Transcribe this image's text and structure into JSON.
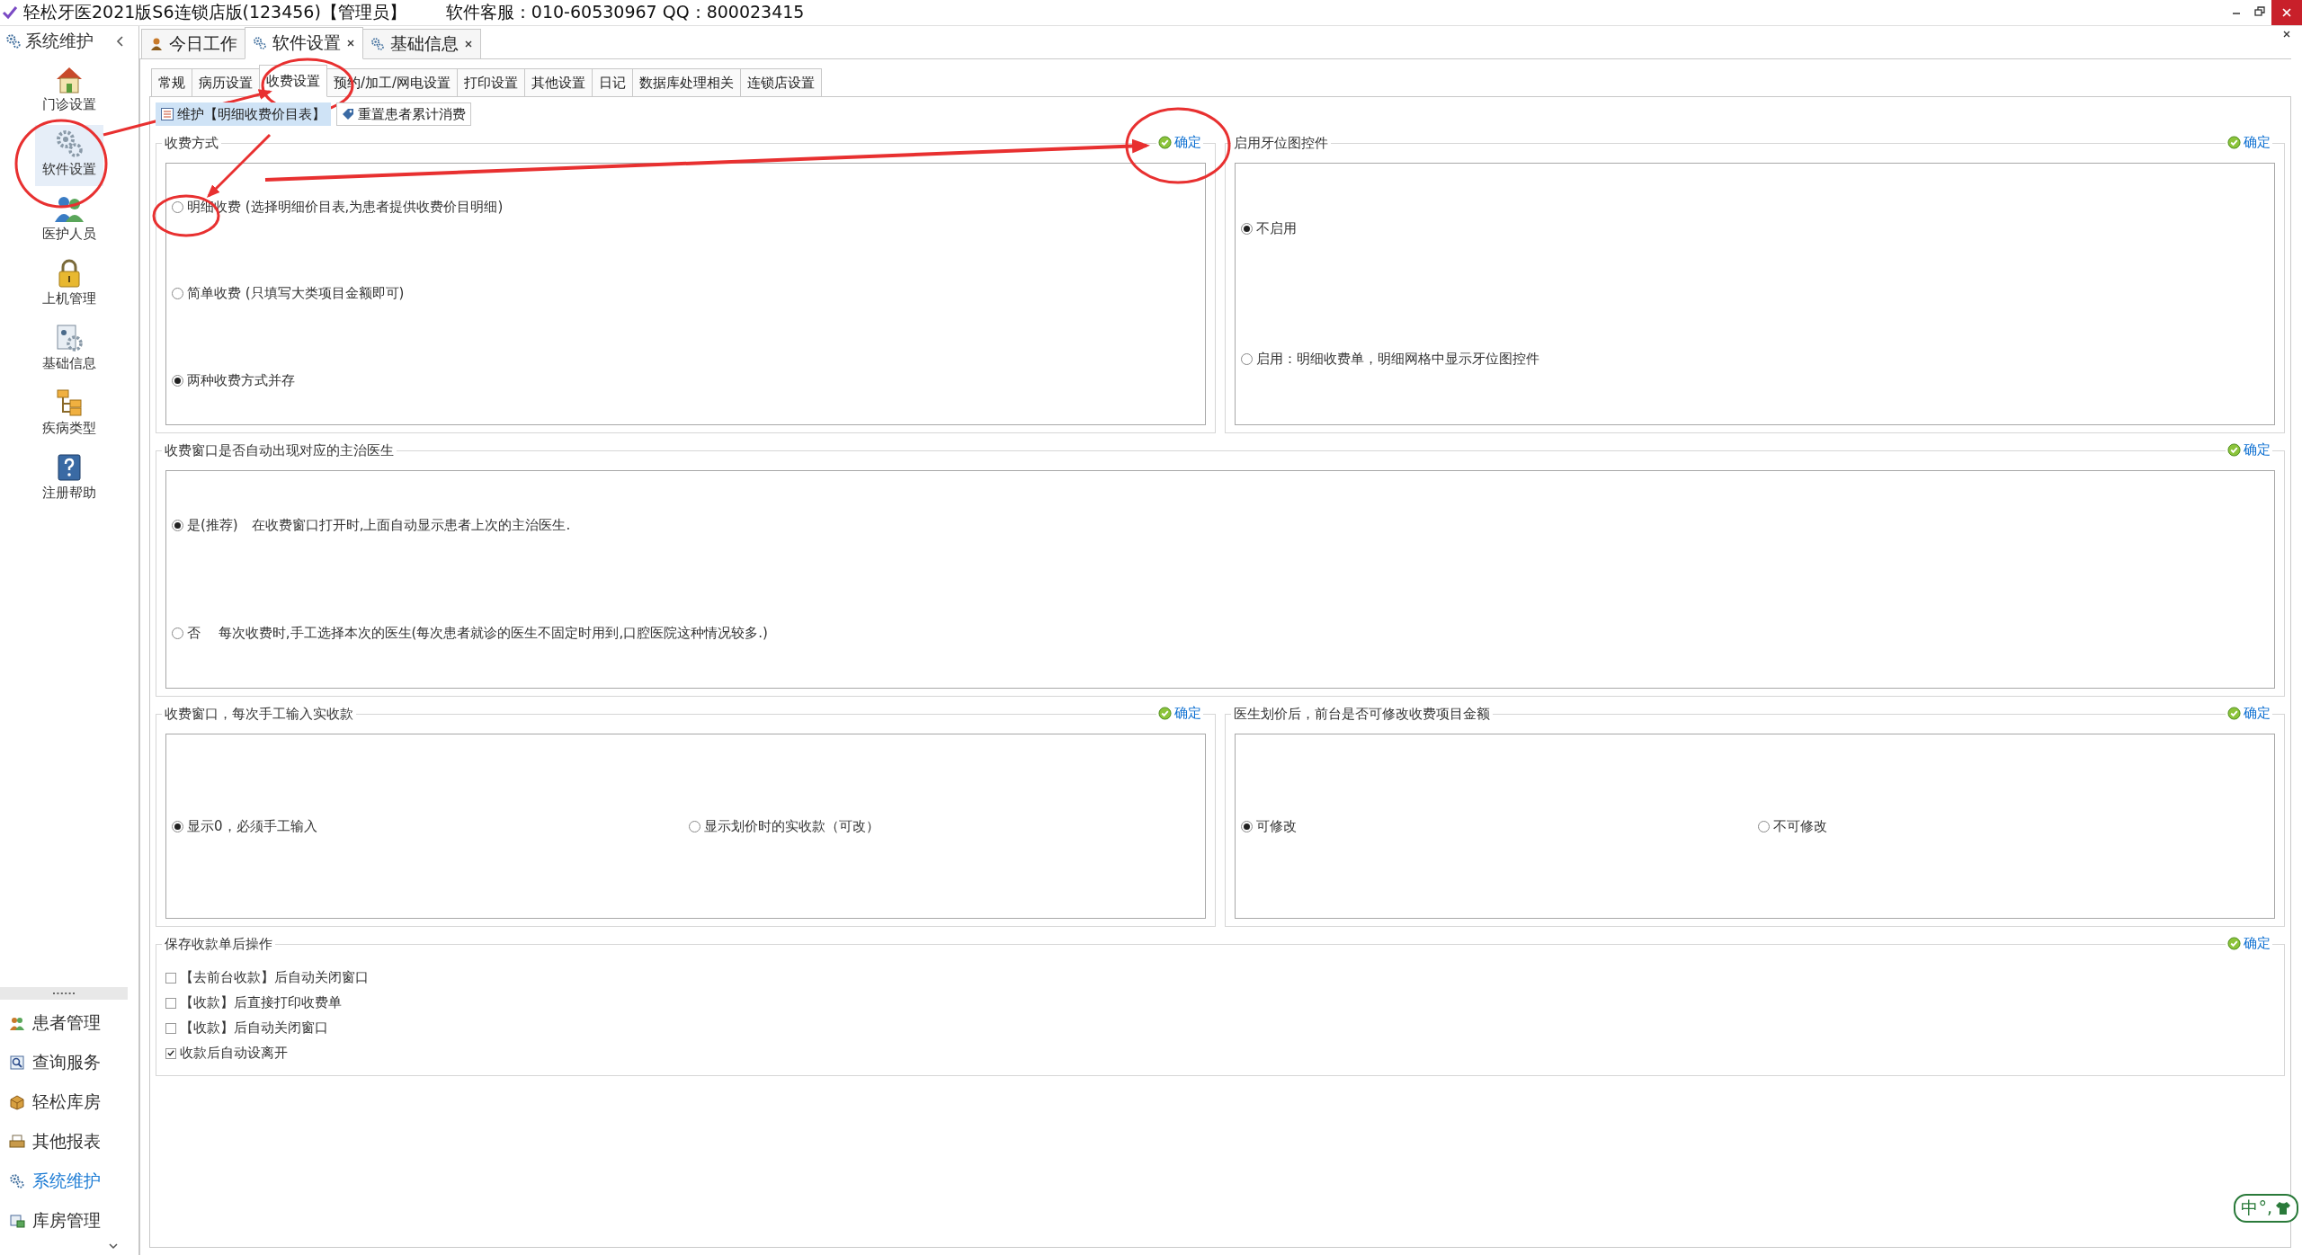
{
  "window": {
    "title": "轻松牙医2021版S6连锁店版(123456)【管理员】",
    "service": "软件客服：010-60530967 QQ：800023415"
  },
  "sidebar": {
    "header": "系统维护",
    "tools": [
      {
        "label": "门诊设置",
        "selected": false
      },
      {
        "label": "软件设置",
        "selected": true
      },
      {
        "label": "医护人员",
        "selected": false
      },
      {
        "label": "上机管理",
        "selected": false
      },
      {
        "label": "基础信息",
        "selected": false
      },
      {
        "label": "疾病类型",
        "selected": false
      },
      {
        "label": "注册帮助",
        "selected": false
      }
    ],
    "modules": [
      {
        "label": "患者管理",
        "selected": false
      },
      {
        "label": "查询服务",
        "selected": false
      },
      {
        "label": "轻松库房",
        "selected": false
      },
      {
        "label": "其他报表",
        "selected": false
      },
      {
        "label": "系统维护",
        "selected": true
      },
      {
        "label": "库房管理",
        "selected": false
      }
    ]
  },
  "doc_tabs": [
    {
      "label": "今日工作",
      "closable": false,
      "selected": false
    },
    {
      "label": "软件设置",
      "closable": true,
      "selected": true
    },
    {
      "label": "基础信息",
      "closable": true,
      "selected": false
    }
  ],
  "settings_tabs": [
    {
      "label": "常规",
      "selected": false
    },
    {
      "label": "病历设置",
      "selected": false
    },
    {
      "label": "收费设置",
      "selected": true
    },
    {
      "label": "预约/加工/网电设置",
      "selected": false
    },
    {
      "label": "打印设置",
      "selected": false
    },
    {
      "label": "其他设置",
      "selected": false
    },
    {
      "label": "日记",
      "selected": false
    },
    {
      "label": "数据库处理相关",
      "selected": false
    },
    {
      "label": "连锁店设置",
      "selected": false
    }
  ],
  "toolbar": [
    {
      "label": "维护【明细收费价目表】",
      "selected": true
    },
    {
      "label": "重置患者累计消费",
      "selected": false
    }
  ],
  "rows": [
    {
      "sections": [
        {
          "title": "收费方式",
          "confirm": "确定",
          "kind": "radios",
          "options": [
            {
              "label": "明细收费 (选择明细价目表,为患者提供收费价目明细)",
              "selected": false
            },
            {
              "label": "简单收费 (只填写大类项目金额即可)",
              "selected": false
            },
            {
              "label": "两种收费方式并存",
              "selected": true
            }
          ]
        },
        {
          "title": "启用牙位图控件",
          "confirm": "确定",
          "kind": "radios",
          "options": [
            {
              "label": "不启用",
              "selected": true
            },
            {
              "label": "启用：明细收费单，明细网格中显示牙位图控件",
              "selected": false
            }
          ]
        }
      ]
    },
    {
      "sections": [
        {
          "title": "收费窗口是否自动出现对应的主治医生",
          "confirm": "确定",
          "kind": "radios",
          "options": [
            {
              "label": "是(推荐)　在收费窗口打开时,上面自动显示患者上次的主治医生.",
              "selected": true
            },
            {
              "label": "否　 每次收费时,手工选择本次的医生(每次患者就诊的医生不固定时用到,口腔医院这种情况较多.)",
              "selected": false
            }
          ]
        }
      ]
    },
    {
      "sections": [
        {
          "title": "收费窗口，每次手工输入实收款",
          "confirm": "确定",
          "kind": "radios",
          "options": [
            {
              "label": "显示0，必须手工输入",
              "selected": true
            },
            {
              "label": "显示划价时的实收款（可改）",
              "selected": false
            }
          ]
        },
        {
          "title": "医生划价后，前台是否可修改收费项目金额",
          "confirm": "确定",
          "kind": "radios",
          "options": [
            {
              "label": "可修改",
              "selected": true
            },
            {
              "label": "不可修改",
              "selected": false
            }
          ]
        }
      ]
    },
    {
      "sections": [
        {
          "title": "保存收款单后操作",
          "confirm": "确定",
          "kind": "checks",
          "options": [
            {
              "label": "【去前台收款】后自动关闭窗口",
              "checked": false
            },
            {
              "label": "【收款】后直接打印收费单",
              "checked": false
            },
            {
              "label": "【收款】后自动关闭窗口",
              "checked": false
            },
            {
              "label": "收款后自动设离开",
              "checked": true
            }
          ]
        }
      ]
    }
  ],
  "ime_toolbar": {
    "label": "中°,"
  }
}
